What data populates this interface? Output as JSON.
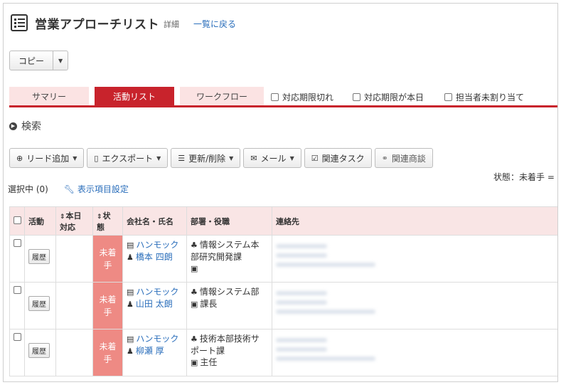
{
  "header": {
    "title": "営業アプローチリスト",
    "subtitle": "詳細",
    "back_link": "一覧に戻る"
  },
  "copy": {
    "label": "コピー"
  },
  "tabs": [
    {
      "label": "サマリー"
    },
    {
      "label": "活動リスト"
    },
    {
      "label": "ワークフロー"
    }
  ],
  "filters": [
    {
      "label": "対応期限切れ"
    },
    {
      "label": "対応期限が本日"
    },
    {
      "label": "担当者未割り当て"
    }
  ],
  "search": {
    "label": "検索"
  },
  "toolbar": {
    "add_lead": "リード追加",
    "export": "エクスポート",
    "update_delete": "更新/削除",
    "mail": "メール",
    "related_task": "関連タスク",
    "related_deal": "関連商談"
  },
  "status_label": "状態：未着手 =",
  "selection": {
    "text": "選択中 (0)",
    "column_settings": "表示項目設定"
  },
  "table": {
    "headers": {
      "activity": "活動",
      "today1": "本日",
      "today2": "対応",
      "status1": "状",
      "status2": "態",
      "company": "会社名・氏名",
      "dept": "部署・役職",
      "contact": "連絡先"
    },
    "rows": [
      {
        "history": "履歴",
        "status1": "未着",
        "status2": "手",
        "company": "ハンモック",
        "person": "橋本 四朗",
        "dept1": "情報システム本",
        "dept2": "部研究開発課",
        "title": ""
      },
      {
        "history": "履歴",
        "status1": "未着",
        "status2": "手",
        "company": "ハンモック",
        "person": "山田 太朗",
        "dept1": "情報システム部",
        "dept2": "",
        "title": "課長"
      },
      {
        "history": "履歴",
        "status1": "未着",
        "status2": "手",
        "company": "ハンモック",
        "person": "柳瀬 厚",
        "dept1": "技術本部技術サ",
        "dept2": "ポート課",
        "title": "主任"
      }
    ]
  },
  "colors": {
    "accent": "#c8232c",
    "tab_inactive": "#fbe3e3",
    "status_cell": "#ee8a84",
    "link": "#2a6ebb"
  }
}
